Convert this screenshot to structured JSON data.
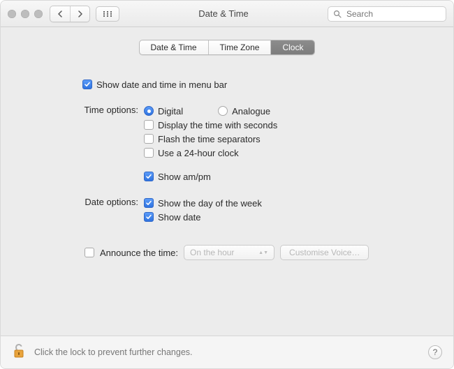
{
  "window": {
    "title": "Date & Time",
    "search_placeholder": "Search"
  },
  "tabs": [
    {
      "label": "Date & Time",
      "active": false
    },
    {
      "label": "Time Zone",
      "active": false
    },
    {
      "label": "Clock",
      "active": true
    }
  ],
  "show_in_menubar": {
    "checked": true,
    "label": "Show date and time in menu bar"
  },
  "time_options": {
    "heading": "Time options:",
    "mode": {
      "digital": {
        "label": "Digital",
        "selected": true
      },
      "analogue": {
        "label": "Analogue",
        "selected": false
      }
    },
    "seconds": {
      "checked": false,
      "label": "Display the time with seconds"
    },
    "flash_sep": {
      "checked": false,
      "label": "Flash the time separators"
    },
    "use_24h": {
      "checked": false,
      "label": "Use a 24-hour clock"
    },
    "show_ampm": {
      "checked": true,
      "label": "Show am/pm"
    }
  },
  "date_options": {
    "heading": "Date options:",
    "show_day": {
      "checked": true,
      "label": "Show the day of the week"
    },
    "show_date": {
      "checked": true,
      "label": "Show date"
    }
  },
  "announce": {
    "checkbox": {
      "checked": false,
      "label": "Announce the time:"
    },
    "interval": "On the hour",
    "voice_button": "Customise Voice…"
  },
  "footer": {
    "message": "Click the lock to prevent further changes.",
    "help": "?"
  }
}
